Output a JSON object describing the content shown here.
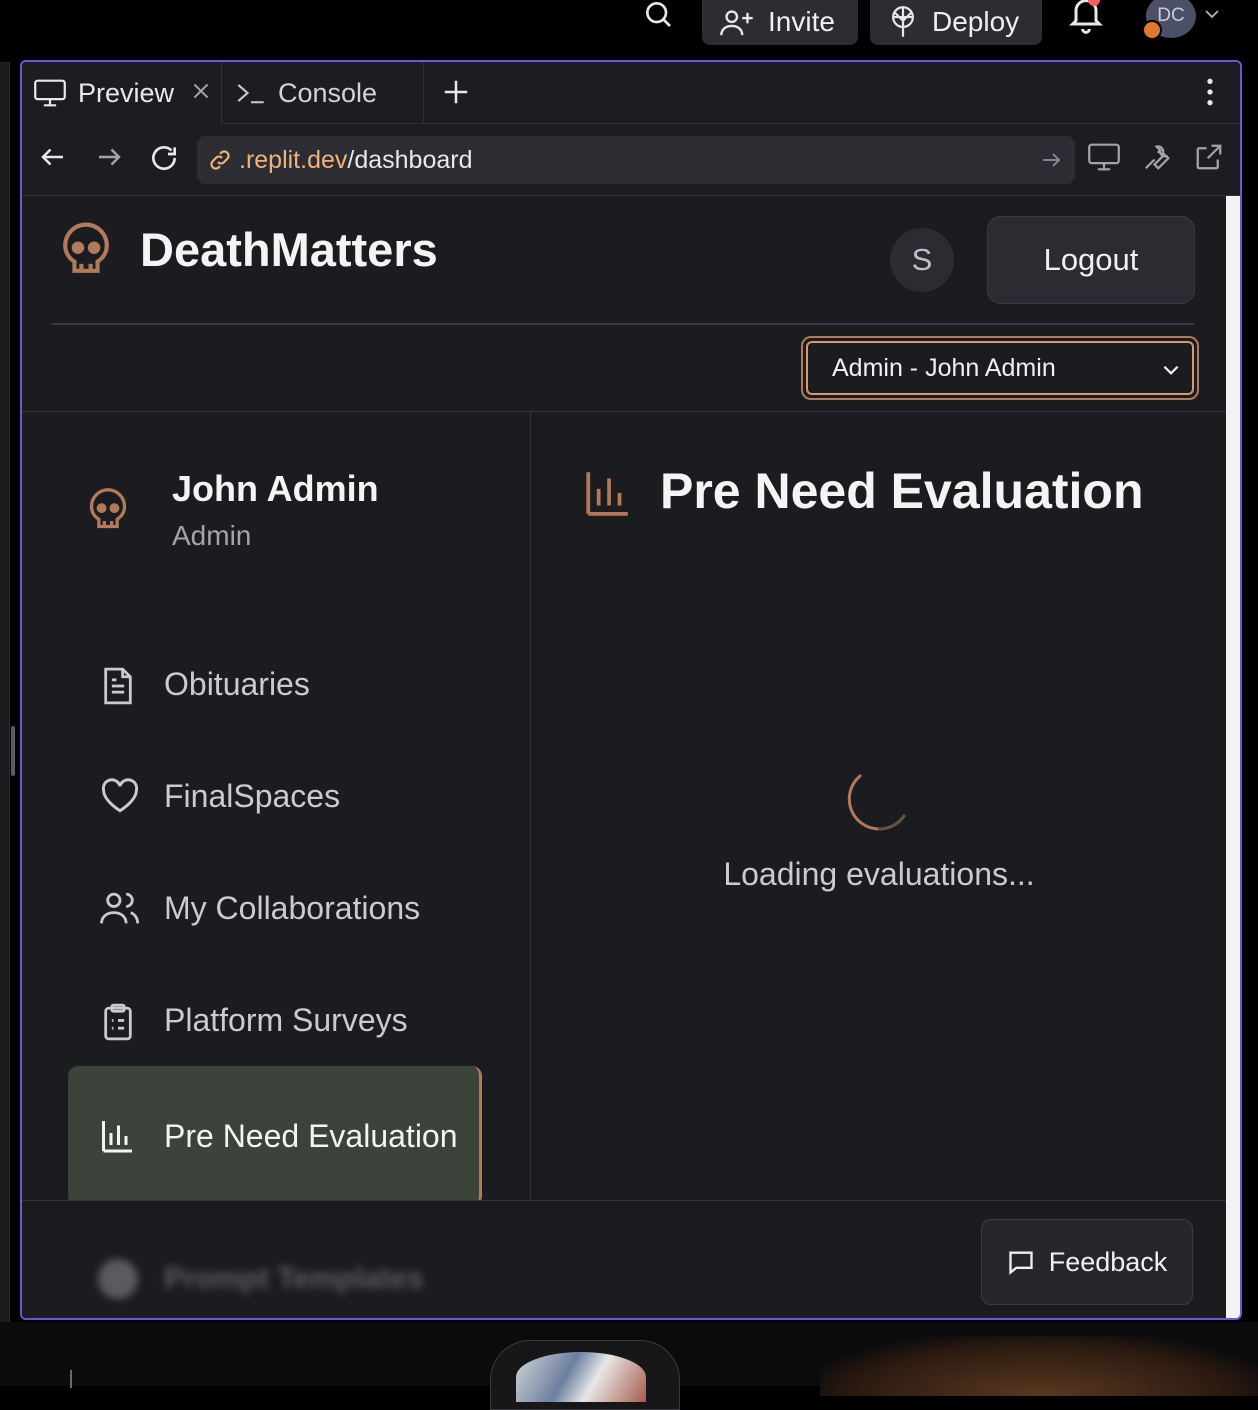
{
  "topbar": {
    "invite_label": "Invite",
    "deploy_label": "Deploy",
    "avatar_initials": "DC"
  },
  "tabs": {
    "preview_label": "Preview",
    "console_label": "Console"
  },
  "url": {
    "host": ".replit.dev",
    "path": "/dashboard"
  },
  "app": {
    "brand_name": "DeathMatters",
    "user_initial": "S",
    "logout_label": "Logout",
    "role_select_value": "Admin - John Admin",
    "profile": {
      "name": "John Admin",
      "role": "Admin"
    },
    "nav": [
      {
        "label": "Obituaries",
        "icon": "document-icon"
      },
      {
        "label": "FinalSpaces",
        "icon": "heart-icon"
      },
      {
        "label": "My Collaborations",
        "icon": "users-icon"
      },
      {
        "label": "Platform Surveys",
        "icon": "clipboard-icon"
      },
      {
        "label": "Pre Need Evaluation",
        "icon": "bar-chart-icon",
        "active": true
      },
      {
        "label": "Prompt Templates",
        "icon": "template-icon"
      }
    ],
    "main": {
      "title": "Pre Need Evaluation",
      "loading_text": "Loading evaluations..."
    },
    "feedback_label": "Feedback"
  },
  "colors": {
    "accent": "#b2795a",
    "pane_border": "#6f56d6",
    "active_nav_bg": "#3b433b",
    "background": "#1b1c20"
  }
}
